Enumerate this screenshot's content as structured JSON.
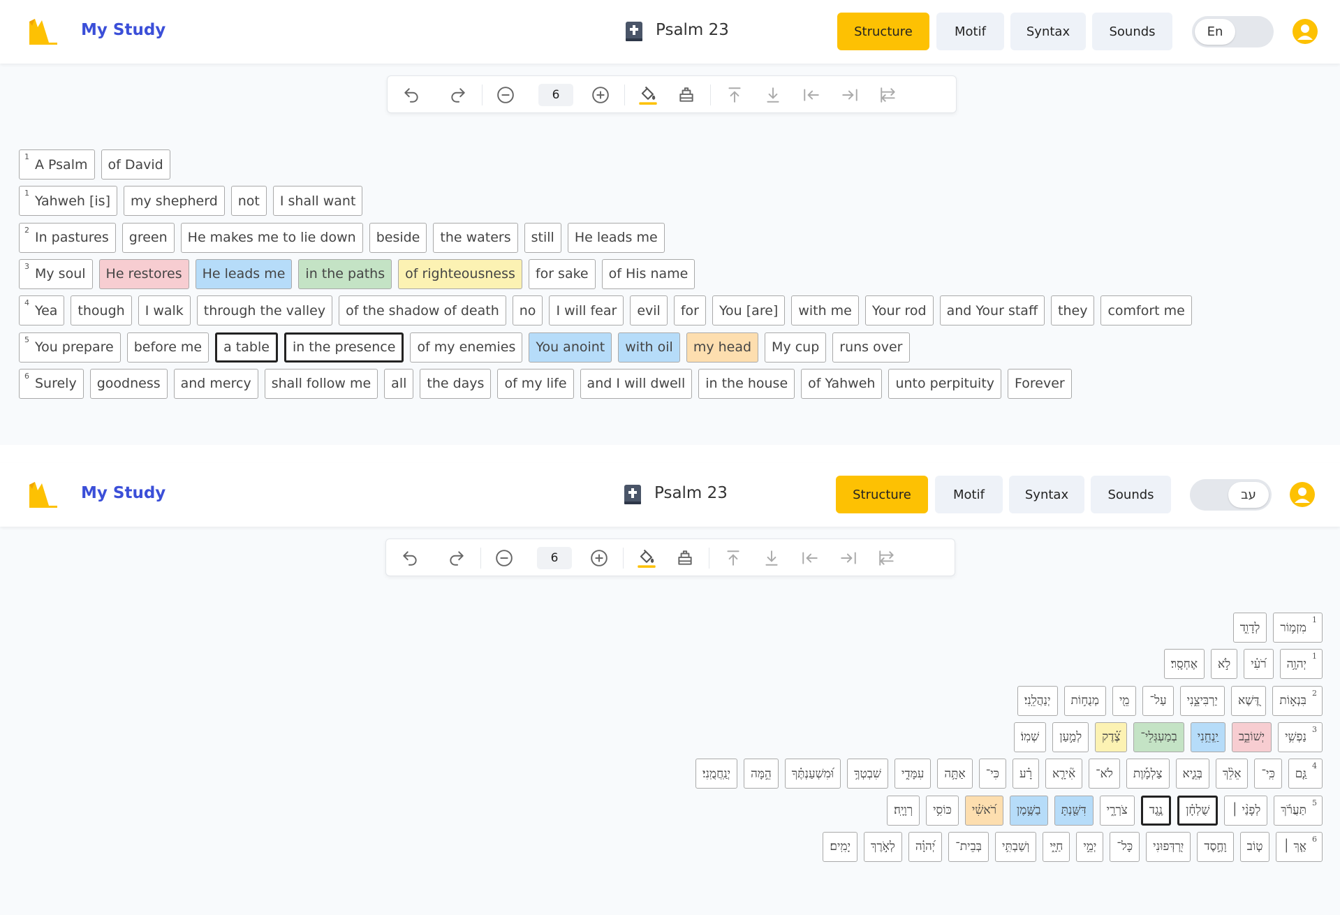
{
  "panels": [
    {
      "header": {
        "app_title": "My Study",
        "psalm_title": "Psalm 23",
        "modes": [
          "Structure",
          "Motif",
          "Syntax",
          "Sounds"
        ],
        "active_mode": "Structure",
        "lang_label": "En",
        "lang_side": "left"
      },
      "toolbar": {
        "zoom": "6"
      },
      "direction": "ltr",
      "lines": [
        {
          "verse": "1",
          "chunks": [
            {
              "text": "A Psalm"
            },
            {
              "text": "of David"
            }
          ]
        },
        {
          "verse": "1",
          "chunks": [
            {
              "text": "Yahweh [is]"
            },
            {
              "text": "my shepherd"
            },
            {
              "text": "not"
            },
            {
              "text": "I shall want"
            }
          ]
        },
        {
          "verse": "2",
          "chunks": [
            {
              "text": "In pastures"
            },
            {
              "text": "green"
            },
            {
              "text": "He makes me to lie down"
            },
            {
              "text": "beside"
            },
            {
              "text": "the waters"
            },
            {
              "text": "still"
            },
            {
              "text": "He leads me"
            }
          ]
        },
        {
          "verse": "3",
          "chunks": [
            {
              "text": "My soul"
            },
            {
              "text": "He restores",
              "color": "red"
            },
            {
              "text": "He leads me",
              "color": "blue"
            },
            {
              "text": "in the paths",
              "color": "green"
            },
            {
              "text": "of righteousness",
              "color": "yellow"
            },
            {
              "text": "for sake"
            },
            {
              "text": "of His name"
            }
          ]
        },
        {
          "verse": "4",
          "chunks": [
            {
              "text": "Yea"
            },
            {
              "text": "though"
            },
            {
              "text": "I walk"
            },
            {
              "text": "through the valley"
            },
            {
              "text": "of the shadow of death"
            },
            {
              "text": "no"
            },
            {
              "text": "I will fear"
            },
            {
              "text": "evil"
            },
            {
              "text": "for"
            },
            {
              "text": "You [are]"
            },
            {
              "text": "with me"
            },
            {
              "text": "Your rod"
            },
            {
              "text": "and Your staff"
            },
            {
              "text": "they"
            },
            {
              "text": "comfort me"
            }
          ]
        },
        {
          "verse": "5",
          "chunks": [
            {
              "text": "You prepare"
            },
            {
              "text": "before me"
            },
            {
              "text": "a table",
              "selected": true
            },
            {
              "text": "in the presence",
              "selected": true
            },
            {
              "text": "of my enemies"
            },
            {
              "text": "You anoint",
              "color": "blue"
            },
            {
              "text": "with oil",
              "color": "blue"
            },
            {
              "text": "my head",
              "color": "orange"
            },
            {
              "text": "My cup"
            },
            {
              "text": "runs over"
            }
          ]
        },
        {
          "verse": "6",
          "chunks": [
            {
              "text": "Surely"
            },
            {
              "text": "goodness"
            },
            {
              "text": "and mercy"
            },
            {
              "text": "shall follow me"
            },
            {
              "text": "all"
            },
            {
              "text": "the days"
            },
            {
              "text": "of my life"
            },
            {
              "text": "and I will dwell"
            },
            {
              "text": "in the house"
            },
            {
              "text": "of Yahweh"
            },
            {
              "text": "unto perpituity"
            },
            {
              "text": "Forever"
            }
          ]
        }
      ]
    },
    {
      "header": {
        "app_title": "My Study",
        "psalm_title": "Psalm 23",
        "modes": [
          "Structure",
          "Motif",
          "Syntax",
          "Sounds"
        ],
        "active_mode": "Structure",
        "lang_label": "עב",
        "lang_side": "right"
      },
      "toolbar": {
        "zoom": "6"
      },
      "direction": "rtl",
      "lines": [
        {
          "verse": "1",
          "chunks": [
            {
              "text": "מִזְמ֥וֹר"
            },
            {
              "text": "לְדָוִ֑ד"
            }
          ]
        },
        {
          "verse": "1",
          "chunks": [
            {
              "text": "יְהוָ֥ה"
            },
            {
              "text": "רֹ֝עִ֗י"
            },
            {
              "text": "לֹ֣א"
            },
            {
              "text": "אֶחְסָֽר׃"
            }
          ]
        },
        {
          "verse": "2",
          "chunks": [
            {
              "text": "בִּנְא֣וֹת"
            },
            {
              "text": "דֶּ֭שֶׁא"
            },
            {
              "text": "יַרְבִּיצֵ֑נִי"
            },
            {
              "text": "עַל־"
            },
            {
              "text": "מֵ֖י"
            },
            {
              "text": "מְנֻח֣וֹת"
            },
            {
              "text": "יְנַהֲלֵֽנִי׃"
            }
          ]
        },
        {
          "verse": "3",
          "chunks": [
            {
              "text": "נַפְשִׁ֥י"
            },
            {
              "text": "יְשׁוֹבֵ֑ב",
              "color": "red"
            },
            {
              "text": "יַֽנְחֵ֥נִי",
              "color": "blue"
            },
            {
              "text": "בְמַעְגְּלֵי־",
              "color": "green"
            },
            {
              "text": "צֶ֝֗דֶק",
              "color": "yellow"
            },
            {
              "text": "לְמַ֣עַן"
            },
            {
              "text": "שְׁמֽוֹ׃"
            }
          ]
        },
        {
          "verse": "4",
          "chunks": [
            {
              "text": "גַּ֤ם"
            },
            {
              "text": "כִּֽי־"
            },
            {
              "text": "אֵלֵ֨ךְ"
            },
            {
              "text": "בְּגֵ֪יא"
            },
            {
              "text": "צַלְמָ֡וֶת"
            },
            {
              "text": "לֹא־"
            },
            {
              "text": "אִ֘ירָ֤א"
            },
            {
              "text": "רָ֗ע"
            },
            {
              "text": "כִּי־"
            },
            {
              "text": "אַתָּ֥ה"
            },
            {
              "text": "עִמָּדִ֑י"
            },
            {
              "text": "שִׁבְטְךָ֥"
            },
            {
              "text": "וּ֝מִשְׁעַנְתֶּ֗ךָ"
            },
            {
              "text": "הֵ֣מָּה"
            },
            {
              "text": "יְנַֽחֲמֻֽנִי׃"
            }
          ]
        },
        {
          "verse": "5",
          "chunks": [
            {
              "text": "תַּעֲרֹ֬ךְ"
            },
            {
              "text": "לְפָנַ֨י ׀"
            },
            {
              "text": "שֻׁלְחָ֗ן",
              "selected": true
            },
            {
              "text": "נֶ֥גֶד",
              "selected": true
            },
            {
              "text": "צֹרְרָ֑י"
            },
            {
              "text": "דִּשַּׁ֖נְתָּ",
              "color": "blue"
            },
            {
              "text": "בַשֶּׁ֥מֶן",
              "color": "blue"
            },
            {
              "text": "רֹ֝אשִׁ֗י",
              "color": "orange"
            },
            {
              "text": "כּוֹסִ֥י"
            },
            {
              "text": "רְוָיָֽה׃"
            }
          ]
        },
        {
          "verse": "6",
          "chunks": [
            {
              "text": "אַ֤ךְ ׀"
            },
            {
              "text": "ט֤וֹב"
            },
            {
              "text": "וָחֶ֣סֶד"
            },
            {
              "text": "יִ֭רְדְּפוּנִי"
            },
            {
              "text": "כָּל־"
            },
            {
              "text": "יְמֵ֣י"
            },
            {
              "text": "חַיָּ֑י"
            },
            {
              "text": "וְשַׁבְתִּ֥י"
            },
            {
              "text": "בְּבֵית־"
            },
            {
              "text": "יְ֝הוָ֗ה"
            },
            {
              "text": "לְאֹ֣רֶךְ"
            },
            {
              "text": "יָמִֽים׃"
            }
          ]
        }
      ]
    }
  ]
}
